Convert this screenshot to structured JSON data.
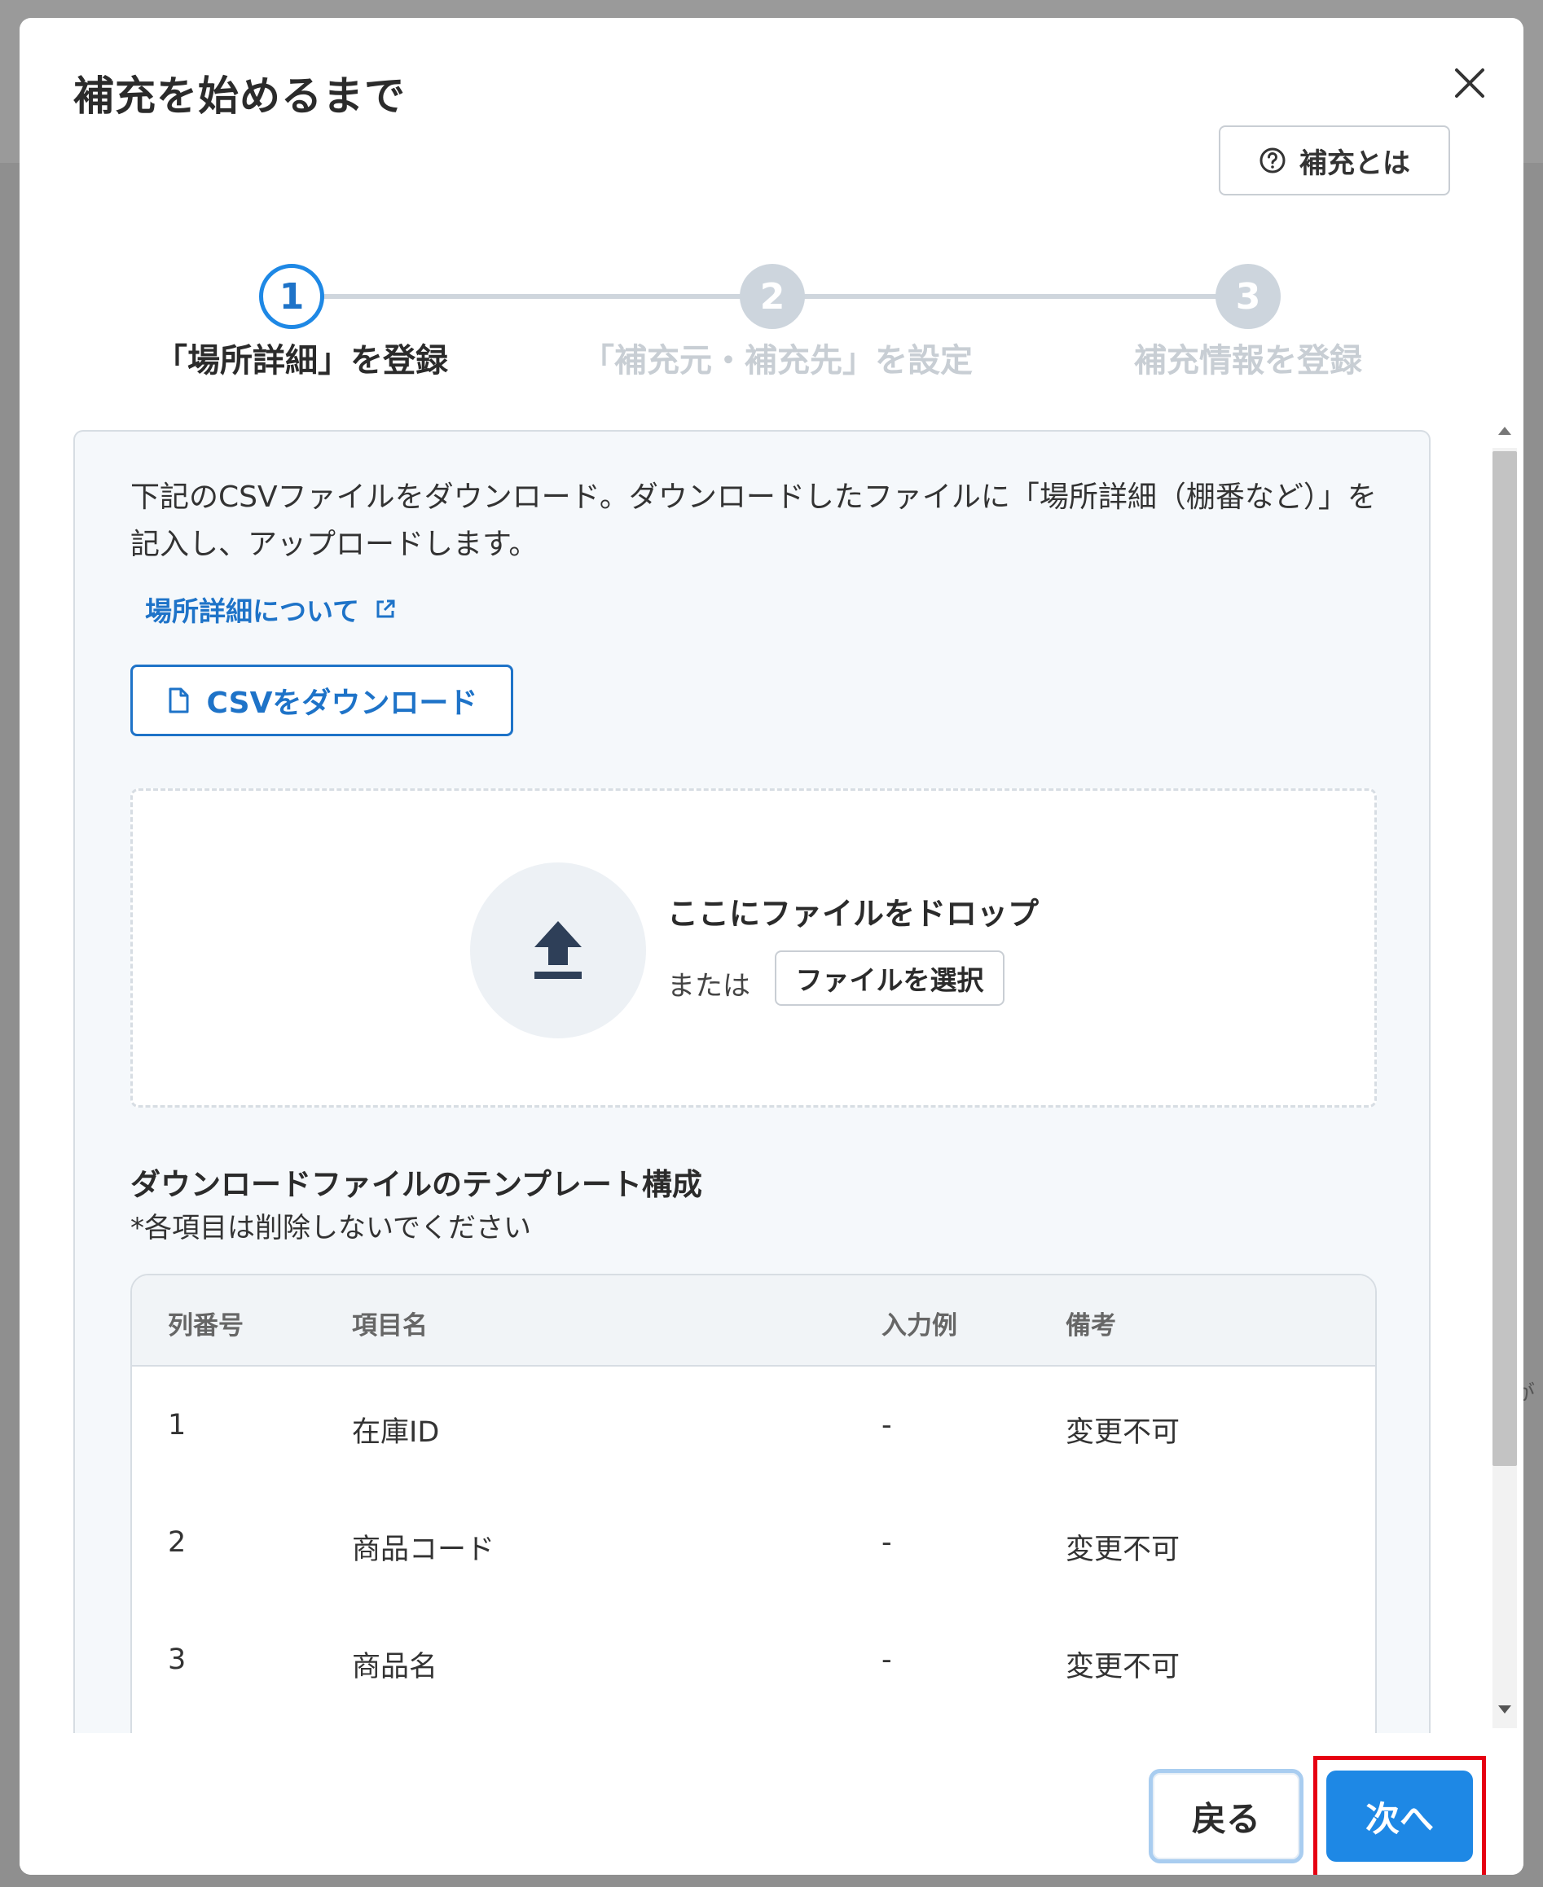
{
  "modal": {
    "title": "補充を始めるまで",
    "help_button_label": "補充とは"
  },
  "stepper": {
    "steps": [
      {
        "number": "1",
        "label": "「場所詳細」を登録",
        "state": "active"
      },
      {
        "number": "2",
        "label": "「補充元・補充先」を設定",
        "state": "inactive"
      },
      {
        "number": "3",
        "label": "補充情報を登録",
        "state": "inactive"
      }
    ]
  },
  "content": {
    "description": "下記のCSVファイルをダウンロード。ダウンロードしたファイルに「場所詳細（棚番など）」を記入し、アップロードします。",
    "link_label": "場所詳細について",
    "csv_button_label": "CSVをダウンロード",
    "dropzone": {
      "title": "ここにファイルをドロップ",
      "or_text": "または",
      "select_button_label": "ファイルを選択"
    },
    "template_section": {
      "title": "ダウンロードファイルのテンプレート構成",
      "note": "*各項目は削除しないでください"
    },
    "table": {
      "headers": [
        "列番号",
        "項目名",
        "入力例",
        "備考"
      ],
      "rows": [
        [
          "1",
          "在庫ID",
          "-",
          "変更不可"
        ],
        [
          "2",
          "商品コード",
          "-",
          "変更不可"
        ],
        [
          "3",
          "商品名",
          "-",
          "変更不可"
        ]
      ]
    }
  },
  "footer": {
    "back_label": "戻る",
    "next_label": "次へ"
  },
  "background": {
    "edge_text": "が"
  },
  "colors": {
    "accent": "#1e88e5",
    "link": "#1e73c8",
    "highlight": "#e60012",
    "inactive_step": "#cdd5dd"
  },
  "icons": {
    "close": "close-icon",
    "help": "question-circle-icon",
    "external_link": "external-link-icon",
    "file": "file-icon",
    "upload": "upload-icon"
  }
}
